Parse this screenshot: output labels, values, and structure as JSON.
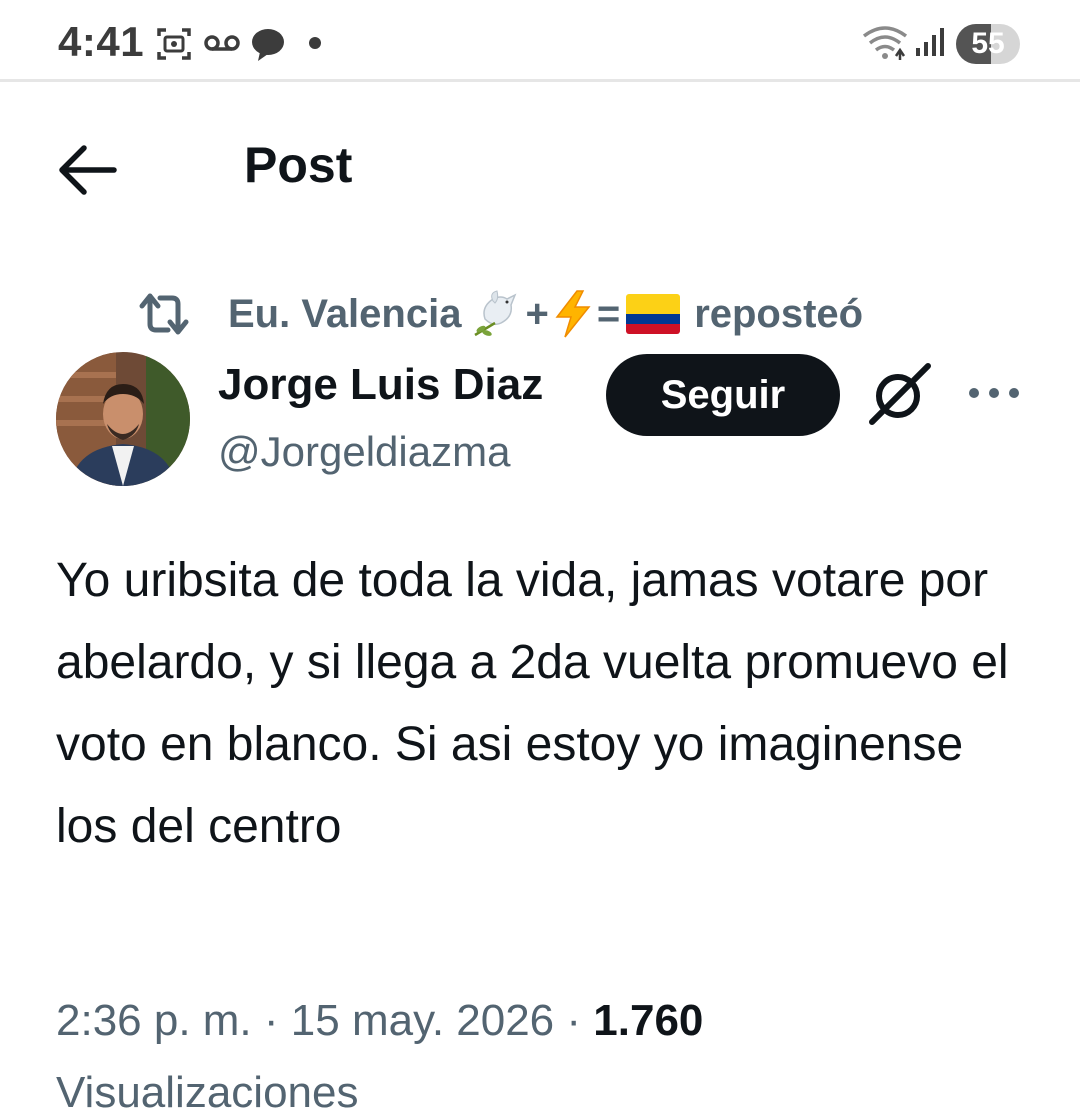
{
  "status_bar": {
    "time": "4:41",
    "battery_level": "55",
    "battery_fraction": 0.55,
    "icons": [
      "screenshot-icon",
      "voicemail-icon",
      "chat-bubble-icon",
      "notification-dot-icon",
      "wifi-icon",
      "signal-icon",
      "battery-icon"
    ]
  },
  "header": {
    "title": "Post",
    "back_icon": "arrow-left-icon"
  },
  "repost": {
    "name": "Eu. Valencia",
    "plus": "+",
    "equals": "=",
    "action": "reposteó",
    "emojis": [
      "dove-of-peace",
      "high-voltage",
      "colombia-flag"
    ],
    "icon": "repost-icon"
  },
  "author": {
    "name": "Jorge Luis Diaz",
    "handle": "@Jorgeldiazma",
    "follow_label": "Seguir"
  },
  "post": {
    "text": "Yo uribsita de toda la vida, jamas votare por abelardo, y si llega a 2da vuelta promuevo el voto en blanco. Si asi estoy yo imaginense los del centro",
    "time": "2:36 p. m.",
    "separator": "·",
    "date": "15 may. 2026",
    "views_count": "1.760",
    "views_label": "Visualizaciones"
  },
  "colors": {
    "text_primary": "#0f1419",
    "text_secondary": "#536471",
    "button_bg": "#0f1419",
    "button_text": "#ffffff",
    "flag_yellow": "#fcd116",
    "flag_blue": "#003893",
    "flag_red": "#ce1126"
  }
}
